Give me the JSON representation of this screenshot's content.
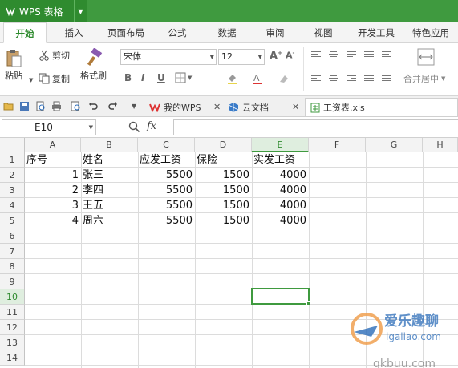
{
  "app": {
    "name": "WPS 表格"
  },
  "ribbon_tabs": [
    "开始",
    "插入",
    "页面布局",
    "公式",
    "数据",
    "审阅",
    "视图",
    "开发工具",
    "特色应用"
  ],
  "active_tab_index": 0,
  "clipboard": {
    "paste": "粘贴",
    "cut": "剪切",
    "copy": "复制",
    "format_painter": "格式刷"
  },
  "font": {
    "name": "宋体",
    "size": "12"
  },
  "font_buttons": {
    "bold": "B",
    "italic": "I",
    "underline": "U"
  },
  "merge_label": "合并居中",
  "doc_tabs": [
    {
      "label": "我的WPS",
      "icon": "wps-logo-icon"
    },
    {
      "label": "云文档",
      "icon": "cloud-doc-icon"
    },
    {
      "label": "工资表.xls",
      "icon": "spreadsheet-icon",
      "active": true
    }
  ],
  "formula_bar": {
    "cell_ref": "E10",
    "fx_label": "fx",
    "content": ""
  },
  "columns": [
    "A",
    "B",
    "C",
    "D",
    "E",
    "F",
    "G",
    "H"
  ],
  "rows": [
    "1",
    "2",
    "3",
    "4",
    "5",
    "6",
    "7",
    "8",
    "9",
    "10",
    "11",
    "12",
    "13",
    "14"
  ],
  "selected_cell": {
    "column": "E",
    "row": "10"
  },
  "table": {
    "headers": [
      "序号",
      "姓名",
      "应发工资",
      "保险",
      "实发工资"
    ],
    "rows": [
      [
        "1",
        "张三",
        "5500",
        "1500",
        "4000"
      ],
      [
        "2",
        "李四",
        "5500",
        "1500",
        "4000"
      ],
      [
        "3",
        "王五",
        "5500",
        "1500",
        "4000"
      ],
      [
        "4",
        "周六",
        "5500",
        "1500",
        "4000"
      ]
    ]
  },
  "watermark": {
    "line1": "爱乐趣聊",
    "line2": "igaliao.com",
    "line3": "qkbuu.com"
  },
  "colors": {
    "accent": "#3f9a3f",
    "title_bar": "#3f9a3f"
  }
}
